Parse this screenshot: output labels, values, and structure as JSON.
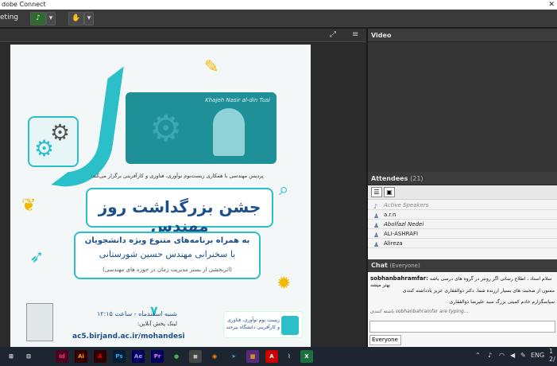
{
  "window": {
    "title": "dobe Connect",
    "close_glyph": "✕"
  },
  "toolbar": {
    "meeting_label": "eting",
    "mic_icon": "speaker-icon",
    "arrow": "▾"
  },
  "share": {
    "fit_icon": "fullscreen-icon",
    "menu_icon": "pod-menu-icon",
    "poster": {
      "portrait_caption": "Khajeh Nasir al-din Tusi",
      "organizer": "پردیس مهندسی با همکاری زیست‌بوم نوآوری، فناوری و کارآفرینی برگزار می‌کند:",
      "title": "جشن بزرگداشت روز مهندس",
      "program_line1": "به همراه برنامه‌های متنوع ویژه دانشجویان",
      "program_line2": "با سخنرانی مهندس حسین شورستانی",
      "program_line3": "(اثربخشی از بستر مدیریت زمان در حوزه های مهندسی)",
      "day": "شنبه",
      "date_number": "۷",
      "date_text": "اسفندماه - ساعت ۱۲:۱۵",
      "link_label": "لینک پخش آنلاین:",
      "link_url": "ac5.birjand.ac.ir/mohandesi",
      "sponsor_text": "زیست بوم نوآوری، فناوری و کارآفرینی دانشگاه بیرجند"
    }
  },
  "video": {
    "title": "Video"
  },
  "attendees": {
    "title": "Attendees",
    "count": "(21)",
    "active_label": "Active Speakers",
    "people": [
      "a.r.n",
      "Abolfazl Nedei",
      "ALI-ASHRAFI",
      "Alireza"
    ]
  },
  "chat": {
    "title": "Chat",
    "audience": "(Everyone)",
    "messages": [
      {
        "author": "sobhanbahramfar:",
        "text": "سلام استاد ، اطلاع رسانی اگر رونتر در گروه های درسی باشه بهتر میشه"
      },
      {
        "author": "",
        "text": "ممنون از صحبت های بسیار ارزنده شما. دکتر ذوالفقاری عزیز  یادداشته کنندی"
      },
      {
        "author": "",
        "text": "سپاسگزارم خادم کمیتی بزرگ  سید علیرضا ذوالفقاری"
      },
      {
        "author": "",
        "text": "sobhanbahramfar are typing..."
      }
    ],
    "target": "Everyone",
    "typing_label": "باشته کنندی"
  },
  "taskbar": {
    "icons": [
      {
        "name": "start-icon",
        "glyph": "⊞",
        "color": "#1c2530",
        "fg": "#fff"
      },
      {
        "name": "taskview-icon",
        "glyph": "⊟",
        "color": "#1c2530",
        "fg": "#fff"
      },
      {
        "name": "indesign-icon",
        "glyph": "Id",
        "color": "#49021f",
        "fg": "#ff3366"
      },
      {
        "name": "illustrator-icon",
        "glyph": "Ai",
        "color": "#330000",
        "fg": "#ff9a00"
      },
      {
        "name": "acrobat-icon",
        "glyph": "A",
        "color": "#2d0000",
        "fg": "#ff0000"
      },
      {
        "name": "photoshop-icon",
        "glyph": "Ps",
        "color": "#001e36",
        "fg": "#31a8ff"
      },
      {
        "name": "aftereffects-icon",
        "glyph": "Ae",
        "color": "#00005b",
        "fg": "#9999ff"
      },
      {
        "name": "premiere-icon",
        "glyph": "Pr",
        "color": "#00005b",
        "fg": "#ea77ff"
      },
      {
        "name": "chrome-icon",
        "glyph": "●",
        "color": "#1c2530",
        "fg": "#4caf50"
      },
      {
        "name": "app-icon",
        "glyph": "◼",
        "color": "#444",
        "fg": "#bbb"
      },
      {
        "name": "firefox-icon",
        "glyph": "◉",
        "color": "#1c2530",
        "fg": "#ff8a00"
      },
      {
        "name": "telegram-icon",
        "glyph": "➤",
        "color": "#1c2530",
        "fg": "#2aa3df"
      },
      {
        "name": "winrar-icon",
        "glyph": "▦",
        "color": "#5a2a7a",
        "fg": "#ffcc00"
      },
      {
        "name": "pdf-icon",
        "glyph": "A",
        "color": "#c00",
        "fg": "#fff"
      },
      {
        "name": "connect-icon",
        "glyph": "⌇",
        "color": "#1c2530",
        "fg": "#ccc"
      },
      {
        "name": "excel-icon",
        "glyph": "X",
        "color": "#1d6f42",
        "fg": "#fff"
      }
    ],
    "lang": "ENG",
    "time": "1",
    "date": "2/"
  }
}
